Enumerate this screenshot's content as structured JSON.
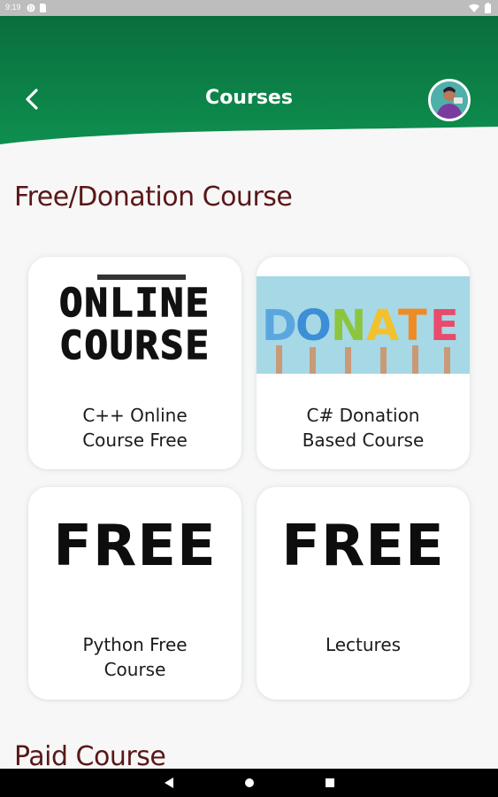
{
  "status_bar": {
    "time": "9:19",
    "icons": [
      "cloud-icon",
      "sim-icon",
      "wifi-icon",
      "battery-icon"
    ]
  },
  "header": {
    "title": "Courses",
    "back_icon": "back-chevron-icon",
    "bg_color": "#0b7a45"
  },
  "sections": {
    "free_title": "Free/Donation Course",
    "paid_title": "Paid Course"
  },
  "courses": [
    {
      "label": "C++ Online Course Free",
      "line1": "C++ Online",
      "line2": "Course Free",
      "image_text_1": "ONLINE",
      "image_text_2": "COURSE"
    },
    {
      "label": "C# Donation Based Course",
      "line1": "C# Donation",
      "line2": "Based Course",
      "image_text": "DONATE"
    },
    {
      "label": "Python Free Course",
      "line1": "Python Free",
      "line2": "Course",
      "image_text": "FREE"
    },
    {
      "label": "Lectures",
      "line1": "Lectures",
      "line2": "",
      "image_text": "FREE"
    }
  ],
  "nav": {
    "back": "nav-back-icon",
    "home": "nav-home-icon",
    "recent": "nav-recent-icon"
  },
  "colors": {
    "accent": "#0b7a45",
    "section_title": "#5a1717"
  }
}
